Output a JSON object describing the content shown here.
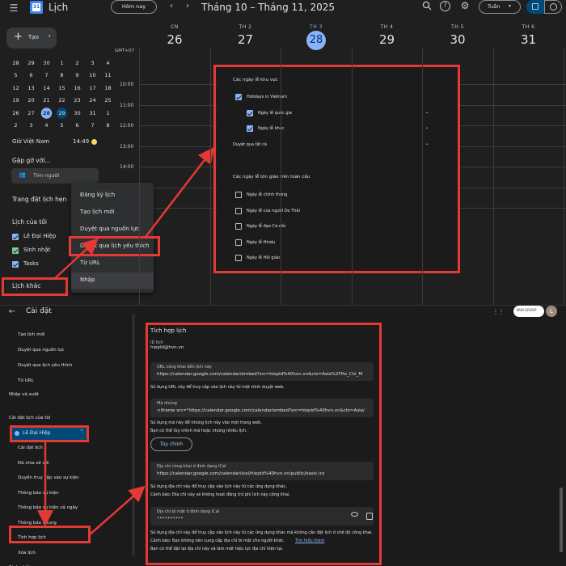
{
  "header": {
    "app_title": "Lịch",
    "today_label": "Hôm nay",
    "date_range": "Tháng 10 – Tháng 11, 2025",
    "view_label": "Tuần"
  },
  "sidebar": {
    "create_label": "Tạo",
    "mini_calendar": [
      [
        "28",
        "29",
        "30",
        "1",
        "2",
        "3",
        "4"
      ],
      [
        "5",
        "6",
        "7",
        "8",
        "9",
        "10",
        "11"
      ],
      [
        "12",
        "13",
        "14",
        "15",
        "16",
        "17",
        "18"
      ],
      [
        "19",
        "20",
        "21",
        "22",
        "23",
        "24",
        "25"
      ],
      [
        "26",
        "27",
        "28",
        "29",
        "30",
        "31",
        "1"
      ],
      [
        "2",
        "3",
        "4",
        "5",
        "6",
        "7",
        "8"
      ]
    ],
    "timezone_label": "Giờ Việt Nam",
    "timezone_time": "14:49",
    "meet_title": "Gặp gỡ với...",
    "search_people": "Tìm người",
    "booking_pages": "Trang đặt lịch hẹn",
    "my_calendars_title": "Lịch của tôi",
    "my_calendars": [
      "Lê Đại Hiệp",
      "Sinh nhật",
      "Tasks"
    ],
    "other_calendars": "Lịch khác"
  },
  "context_menu": [
    "Đăng ký lịch",
    "Tạo lịch mới",
    "Duyệt qua nguồn lực",
    "Duyệt qua lịch yêu thích",
    "Từ URL",
    "Nhập"
  ],
  "week": {
    "gmt": "GMT+07",
    "days": [
      {
        "name": "CN",
        "num": "26"
      },
      {
        "name": "TH 2",
        "num": "27"
      },
      {
        "name": "TH 3",
        "num": "28"
      },
      {
        "name": "TH 4",
        "num": "29"
      },
      {
        "name": "TH 5",
        "num": "30"
      },
      {
        "name": "TH 6",
        "num": "31"
      }
    ],
    "hours": [
      "10:00",
      "11:00",
      "12:00",
      "13:00",
      "14:00",
      "15:00",
      "16:00"
    ]
  },
  "holidays_panel": {
    "regional_title": "Các ngày lễ khu vực",
    "vietnam": "Holidays in Vietnam",
    "national": "Ngày lễ quốc gia",
    "other": "Ngày lễ khác",
    "browse_all": "Duyệt qua tất cả",
    "religious_title": "Các ngày lễ tôn giáo trên toàn cầu",
    "religious": [
      "Ngày lễ chính thống",
      "Ngày lễ của người Do Thái",
      "Ngày lễ đạo Cơ-đốc",
      "Ngày lễ Hindu",
      "Ngày lễ Hồi giáo"
    ]
  },
  "settings": {
    "back_title": "Cài đặt",
    "items_top": [
      "Tạo lịch mới",
      "Duyệt qua nguồn lực",
      "Duyệt qua lịch yêu thích",
      "Từ URL"
    ],
    "import_export": "Nhập và xuất",
    "my_cal_settings": "Cài đặt lịch của tôi",
    "selected_calendar": "Lê Đại Hiệp",
    "sub_items": [
      "Cài đặt lịch",
      "Đã chia sẻ với",
      "Quyền truy cập vào sự kiện",
      "Thông báo sự kiện",
      "Thông báo sự kiện cả ngày",
      "Thông báo chung",
      "Tích hợp lịch",
      "Xóa lịch",
      "Sinh nhật"
    ],
    "brand": "NVN GROUP",
    "avatar": "L"
  },
  "integration": {
    "title": "Tích hợp lịch",
    "id_label": "ID lịch",
    "id_value": "hiepld@hvn.vn",
    "public_url_label": "URL công khai đến lịch này",
    "public_url": "https://calendar.google.com/calendar/embed?src=hiepld%40hvn.vn&ctz=Asia%2FHo_Chi_M",
    "public_url_note": "Sử dụng URL này để truy cập vào lịch này từ một trình duyệt web.",
    "embed_label": "Mã nhúng",
    "embed_code": "<iframe src=\"https://calendar.google.com/calendar/embed?src=hiepld%40hvn.vn&ctz=Asia/",
    "embed_note1": "Sử dụng mã này để nhúng lịch này vào một trang web.",
    "embed_note2": "Bạn có thể tùy chỉnh mã hoặc nhúng nhiều lịch.",
    "customize_btn": "Tùy chỉnh",
    "ical_public_label": "Địa chỉ công khai ở định dạng iCal",
    "ical_public": "https://calendar.google.com/calendar/ical/hiepld%40hvn.vn/public/basic.ics",
    "ical_note1": "Sử dụng địa chỉ này để truy cập vào lịch này từ các ứng dụng khác.",
    "ical_note2": "Cảnh báo: Địa chỉ này sẽ không hoạt động trừ phi lịch này công khai.",
    "secret_label": "Địa chỉ bí mật ở định dạng iCal",
    "secret_value": "••••••••••",
    "secret_note1": "Sử dụng địa chỉ này để truy cập vào lịch này từ các ứng dụng khác mà không cần đặt lịch ở chế độ công khai.",
    "secret_note2": "Cảnh báo: Bạn không nên cung cấp địa chỉ bí mật cho người khác.",
    "learn_more": "Tìm hiểu thêm",
    "secret_note3": "Bạn có thể đặt lại địa chỉ này và làm mất hiệu lực địa chỉ hiện tại."
  },
  "colors": {
    "accent": "#8ab4f8",
    "annotation": "#e53935",
    "bg": "#1f1f1f"
  }
}
